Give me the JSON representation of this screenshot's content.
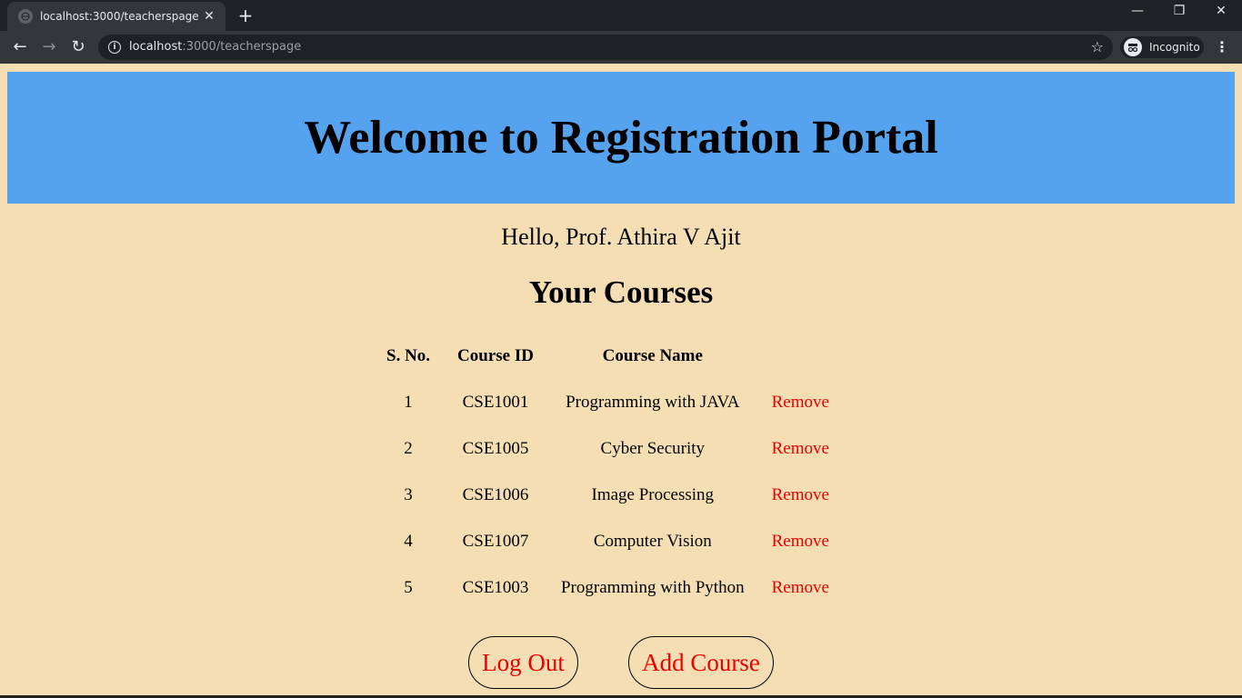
{
  "browser": {
    "tab_title": "localhost:3000/teacherspage",
    "url_host": "localhost",
    "url_rest": ":3000/teacherspage",
    "incognito_label": "Incognito"
  },
  "page": {
    "banner_title": "Welcome to Registration Portal",
    "greeting": "Hello, Prof. Athira V Ajit",
    "courses_heading": "Your Courses",
    "table": {
      "headers": [
        "S. No.",
        "Course ID",
        "Course Name"
      ],
      "rows": [
        {
          "sno": "1",
          "course_id": "CSE1001",
          "course_name": "Programming with JAVA",
          "action": "Remove"
        },
        {
          "sno": "2",
          "course_id": "CSE1005",
          "course_name": "Cyber Security",
          "action": "Remove"
        },
        {
          "sno": "3",
          "course_id": "CSE1006",
          "course_name": "Image Processing",
          "action": "Remove"
        },
        {
          "sno": "4",
          "course_id": "CSE1007",
          "course_name": "Computer Vision",
          "action": "Remove"
        },
        {
          "sno": "5",
          "course_id": "CSE1003",
          "course_name": "Programming with Python",
          "action": "Remove"
        }
      ]
    },
    "logout_label": "Log Out",
    "add_course_label": "Add Course"
  },
  "colors": {
    "page_bg": "#f5deb3",
    "banner_bg": "#55a3ef",
    "link_red": "#e00000"
  }
}
